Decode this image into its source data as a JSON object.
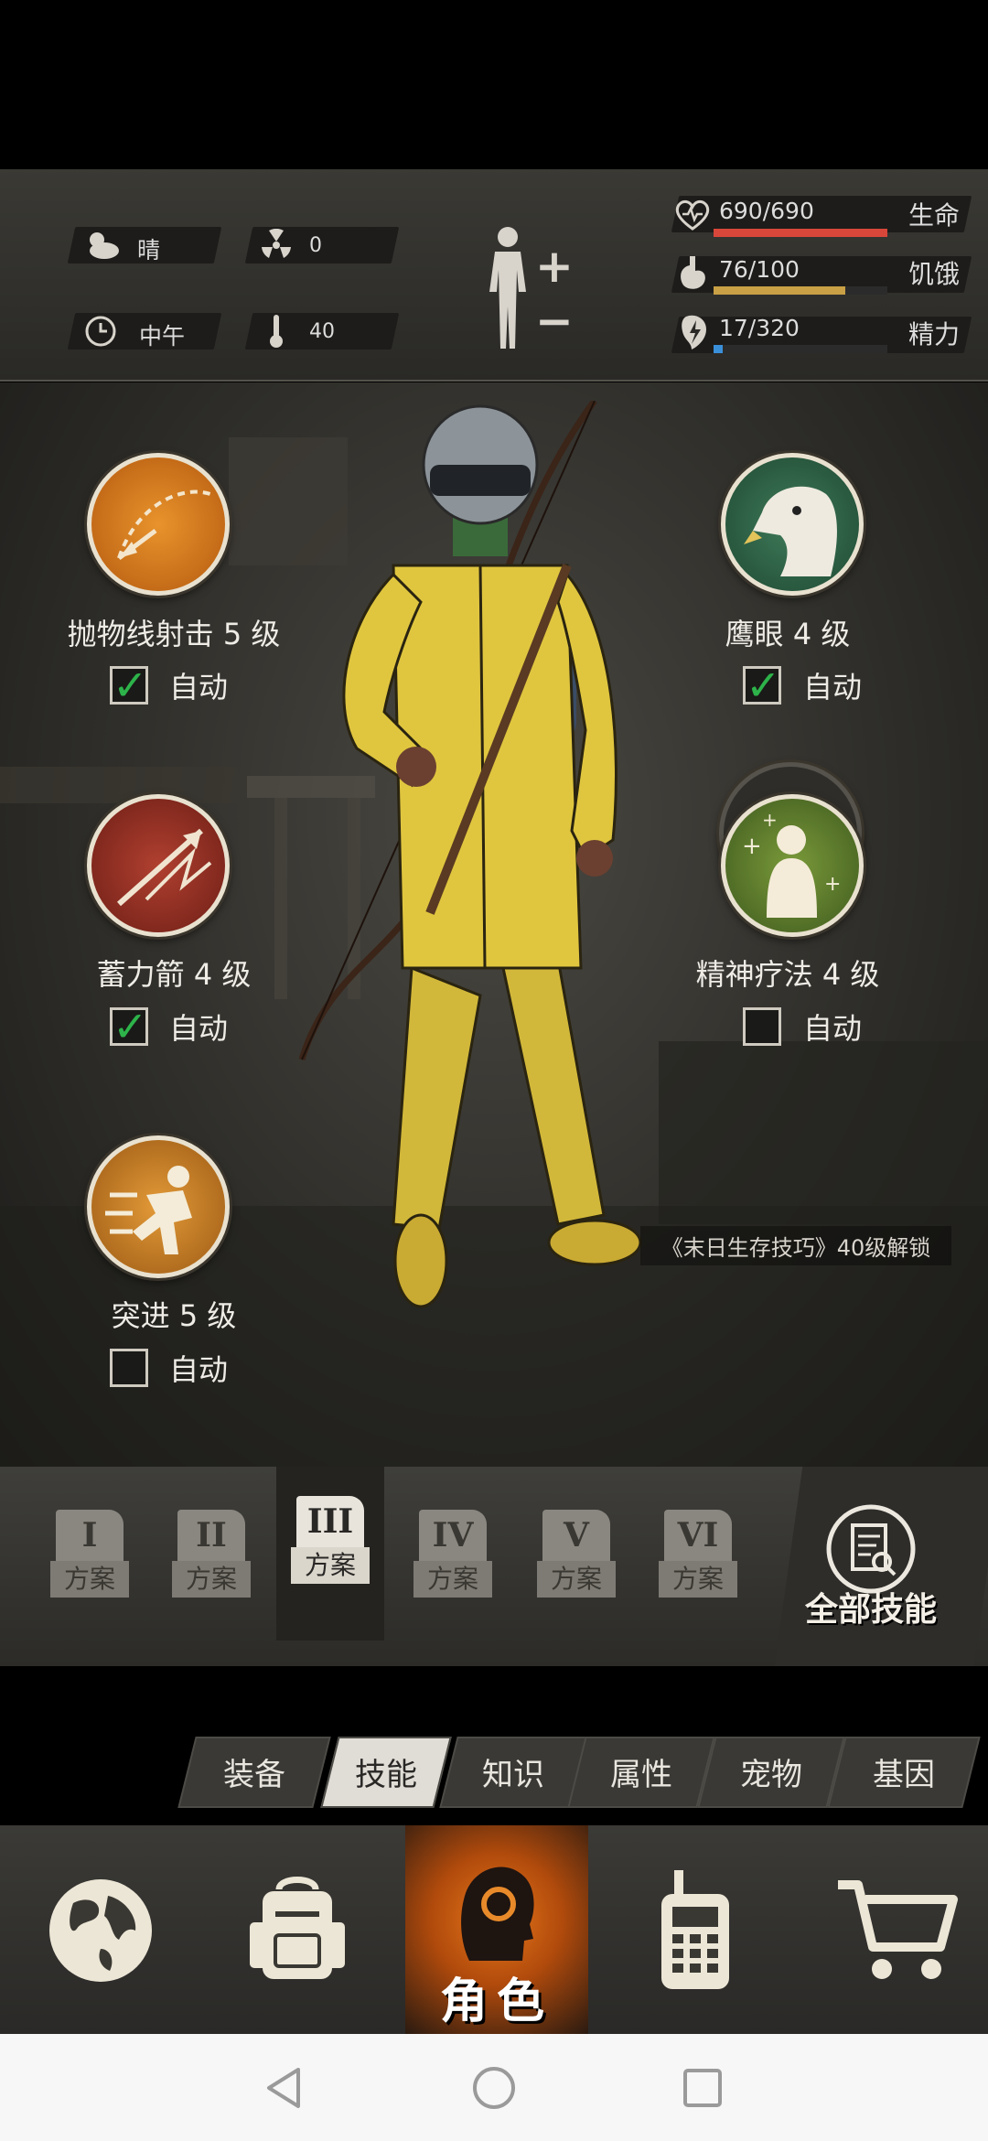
{
  "status": {
    "weather": "晴",
    "radiation": "0",
    "time": "中午",
    "temperature": "40",
    "health": {
      "text": "690/690",
      "label": "生命",
      "fraction": 1.0,
      "color": "#d9463a"
    },
    "hunger": {
      "text": "76/100",
      "label": "饥饿",
      "fraction": 0.76,
      "color": "#c9a045"
    },
    "energy": {
      "text": "17/320",
      "label": "精力",
      "fraction": 0.053,
      "color": "#3a8fd9"
    }
  },
  "skills": [
    {
      "name": "抛物线射击 5 级",
      "auto_label": "自动",
      "auto_checked": true,
      "icon": "parabolic-arrow-icon"
    },
    {
      "name": "鹰眼 4 级",
      "auto_label": "自动",
      "auto_checked": true,
      "icon": "eagle-icon"
    },
    {
      "name": "蓄力箭 4 级",
      "auto_label": "自动",
      "auto_checked": true,
      "icon": "charged-arrow-icon"
    },
    {
      "name": "精神疗法 4 级",
      "auto_label": "自动",
      "auto_checked": false,
      "icon": "mental-therapy-icon"
    },
    {
      "name": "突进 5 级",
      "auto_label": "自动",
      "auto_checked": false,
      "icon": "dash-icon"
    }
  ],
  "locked_skill": {
    "text": "《末日生存技巧》40级解锁",
    "icon": "lock-icon"
  },
  "plans": [
    {
      "numeral": "I",
      "label": "方案"
    },
    {
      "numeral": "II",
      "label": "方案"
    },
    {
      "numeral": "III",
      "label": "方案"
    },
    {
      "numeral": "IV",
      "label": "方案"
    },
    {
      "numeral": "V",
      "label": "方案"
    },
    {
      "numeral": "VI",
      "label": "方案"
    }
  ],
  "active_plan": "III",
  "all_skills_label": "全部技能",
  "tabs": [
    "装备",
    "技能",
    "知识",
    "属性",
    "宠物",
    "基因"
  ],
  "active_tab": "技能",
  "nav": {
    "character_label": "角色"
  }
}
